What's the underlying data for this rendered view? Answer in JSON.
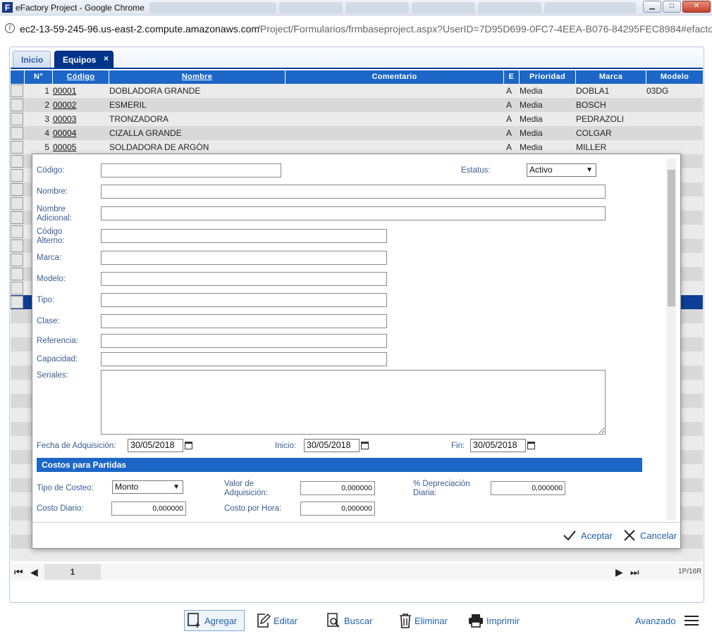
{
  "window": {
    "title": "eFactory Project - Google Chrome",
    "app_icon": "F",
    "controls": {
      "minimize": "▁",
      "maximize": "□",
      "close": "✕"
    }
  },
  "browser": {
    "url_host": "ec2-13-59-245-96.us-east-2.compute.amazonaws.com",
    "url_path": "/Project/Formularios/frmbaseproject.aspx?UserID=7D95D699-0FC7-4EEA-B076-84295FEC8984#efactory"
  },
  "tabs": [
    {
      "label": "Inicio",
      "active": false
    },
    {
      "label": "Equipos",
      "active": true,
      "close": "×"
    }
  ],
  "grid": {
    "columns": [
      "N°",
      "Código",
      "Nombre",
      "Comentario",
      "E",
      "Prioridad",
      "Marca",
      "Modelo"
    ],
    "rows": [
      {
        "n": "1",
        "codigo": "00001",
        "nombre": "DOBLADORA GRANDE",
        "comentario": "",
        "e": "A",
        "prioridad": "Media",
        "marca": "DOBLA1",
        "modelo": "03DG"
      },
      {
        "n": "2",
        "codigo": "00002",
        "nombre": "ESMERIL",
        "comentario": "",
        "e": "A",
        "prioridad": "Media",
        "marca": "BOSCH",
        "modelo": ""
      },
      {
        "n": "3",
        "codigo": "00003",
        "nombre": "TRONZADORA",
        "comentario": "",
        "e": "A",
        "prioridad": "Media",
        "marca": "PEDRAZOLI",
        "modelo": ""
      },
      {
        "n": "4",
        "codigo": "00004",
        "nombre": "CIZALLA GRANDE",
        "comentario": "",
        "e": "A",
        "prioridad": "Media",
        "marca": "COLGAR",
        "modelo": ""
      },
      {
        "n": "5",
        "codigo": "00005",
        "nombre": "SOLDADORA DE ARGÓN",
        "comentario": "",
        "e": "A",
        "prioridad": "Media",
        "marca": "MILLER",
        "modelo": ""
      }
    ]
  },
  "pager": {
    "page": "1",
    "summary": "1P/16R",
    "first": "⏮",
    "prev": "◀",
    "next": "▶",
    "last": "⏭"
  },
  "form": {
    "labels": {
      "codigo": "Código:",
      "estatus": "Estatus:",
      "nombre": "Nombre:",
      "nombre_adicional_1": "Nombre",
      "nombre_adicional_2": "Adicional:",
      "codigo_alterno_1": "Código",
      "codigo_alterno_2": "Alterno:",
      "marca": "Marca:",
      "modelo": "Modelo:",
      "tipo": "Tipo:",
      "clase": "Clase:",
      "referencia": "Referencia:",
      "capacidad": "Capacidad:",
      "seriales": "Seriales:",
      "fecha_adquisicion": "Fecha de Adquisición:",
      "inicio": "Inicio:",
      "fin": "Fin:",
      "tipo_costeo": "Tipo de Costeo:",
      "valor_adquisicion_1": "Valor de",
      "valor_adquisicion_2": "Adquisición:",
      "depreciacion_1": "% Depreciación",
      "depreciacion_2": "Diaria:",
      "costo_diario": "Costo Diario:",
      "costo_hora": "Costo por Hora:"
    },
    "values": {
      "estatus": "Activo",
      "fecha_adquisicion": "30/05/2018",
      "inicio": "30/05/2018",
      "fin": "30/05/2018",
      "tipo_costeo": "Monto",
      "valor_adquisicion": "0,000000",
      "depreciacion": "0,000000",
      "costo_diario": "0,000000",
      "costo_hora": "0,000000"
    },
    "section_title": "Costos para Partidas",
    "accept_label": "Aceptar",
    "cancel_label": "Cancelar"
  },
  "toolbar": {
    "agregar": "Agregar",
    "editar": "Editar",
    "buscar": "Buscar",
    "eliminar": "Eliminar",
    "imprimir": "Imprimir",
    "avanzado": "Avanzado"
  },
  "colors": {
    "header_blue": "#1b66c6",
    "tab_active": "#00348b",
    "selected_row": "#0d3f94",
    "label_blue": "#3b5d91",
    "button_blue": "#2461a8"
  }
}
